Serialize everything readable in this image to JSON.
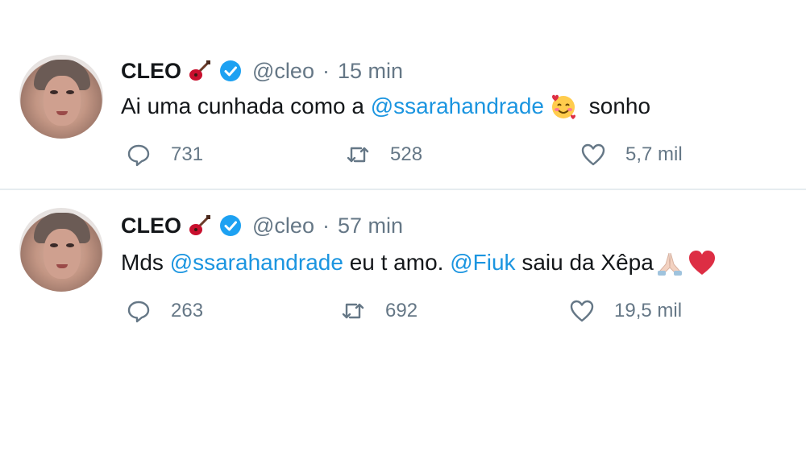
{
  "tweets": [
    {
      "author": {
        "name": "CLEO",
        "handle": "@cleo"
      },
      "time": "15 min",
      "text": {
        "before": "Ai uma cunhada como a ",
        "mention": "@ssarahandrade",
        "after": " sonho"
      },
      "emoji": [
        "smiling-face-with-hearts-emoji"
      ],
      "stats": {
        "replies": "731",
        "retweets": "528",
        "likes": "5,7 mil"
      }
    },
    {
      "author": {
        "name": "CLEO",
        "handle": "@cleo"
      },
      "time": "57 min",
      "text": {
        "start": "Mds ",
        "mention1": "@ssarahandrade",
        "middle": " eu t amo. ",
        "mention2": "@Fiuk",
        "end": " saiu da Xêpa"
      },
      "emoji": [
        "folded-hands-emoji",
        "red-heart-emoji"
      ],
      "stats": {
        "replies": "263",
        "retweets": "692",
        "likes": "19,5 mil"
      }
    }
  ],
  "colors": {
    "mention": "#1b95e0",
    "muted": "#657786",
    "verified": "#1da1f2",
    "heart": "#e0245e"
  },
  "separator": "·"
}
